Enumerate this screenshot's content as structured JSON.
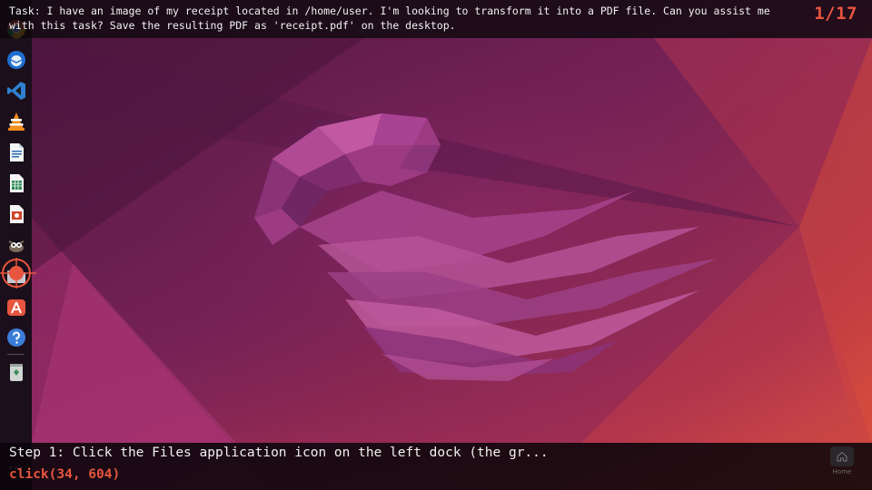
{
  "task": {
    "text": "Task: I have an image of my receipt located in /home/user. I'm looking to transform it into a PDF file. Can you assist me with this task? Save the resulting PDF as 'receipt.pdf' on the desktop.",
    "step_counter": "1/17"
  },
  "step": {
    "description": "Step 1: Click the Files application icon on the left dock (the gr...",
    "action": "click(34, 604)"
  },
  "dock": {
    "items": [
      {
        "name": "chrome",
        "icon": "chrome-icon"
      },
      {
        "name": "thunderbird",
        "icon": "thunderbird-icon"
      },
      {
        "name": "vscode",
        "icon": "vscode-icon"
      },
      {
        "name": "vlc",
        "icon": "vlc-icon"
      },
      {
        "name": "writer",
        "icon": "libreoffice-writer-icon"
      },
      {
        "name": "calc",
        "icon": "libreoffice-calc-icon"
      },
      {
        "name": "impress",
        "icon": "libreoffice-impress-icon"
      },
      {
        "name": "gimp",
        "icon": "gimp-icon"
      },
      {
        "name": "files",
        "icon": "files-icon"
      },
      {
        "name": "app-center",
        "icon": "app-center-icon"
      },
      {
        "name": "help",
        "icon": "help-icon"
      },
      {
        "name": "trash",
        "icon": "trash-icon"
      }
    ]
  },
  "home_widget": {
    "label": "Home",
    "icon": "home-icon"
  },
  "colors": {
    "accent": "#e8553e",
    "dock_bg": "#1a0f1b",
    "wallpaper_base": "#6a1f55"
  }
}
